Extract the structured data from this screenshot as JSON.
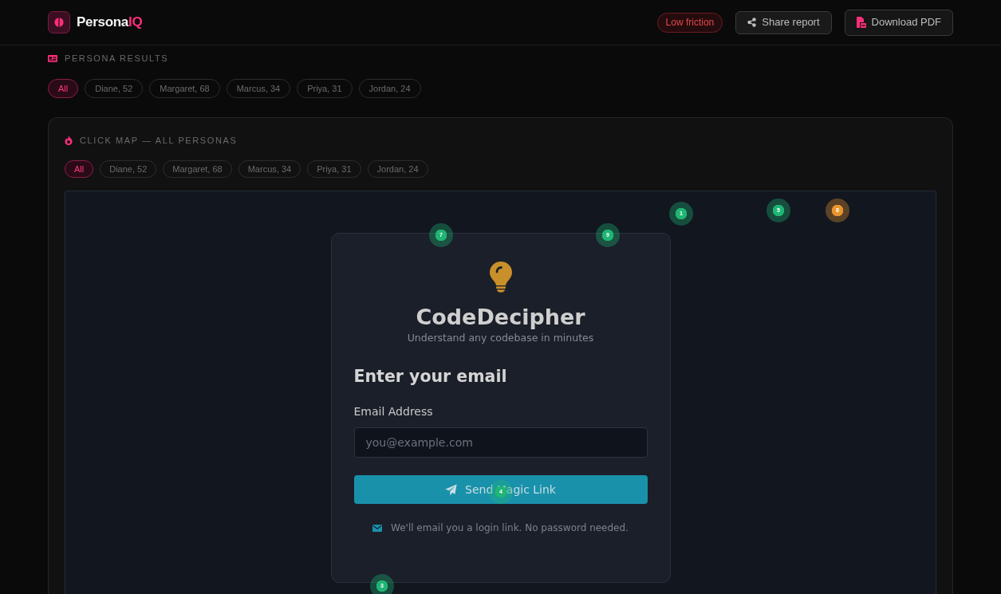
{
  "header": {
    "brand": {
      "text": "Persona",
      "accent": "IQ"
    },
    "status": "Low friction",
    "actions": [
      {
        "label": "Share report",
        "kind": "share"
      },
      {
        "label": "Download PDF",
        "kind": "pdf"
      }
    ]
  },
  "persona_results": {
    "title": "PERSONA RESULTS",
    "filters": [
      {
        "label": "All",
        "selected": true
      },
      {
        "label": "Diane, 52",
        "selected": false
      },
      {
        "label": "Margaret, 68",
        "selected": false
      },
      {
        "label": "Marcus, 34",
        "selected": false
      },
      {
        "label": "Priya, 31",
        "selected": false
      },
      {
        "label": "Jordan, 24",
        "selected": false
      }
    ]
  },
  "click_map": {
    "title": "CLICK MAP — ALL PERSONAS",
    "filters": [
      {
        "label": "All",
        "selected": true
      },
      {
        "label": "Diane, 52",
        "selected": false
      },
      {
        "label": "Margaret, 68",
        "selected": false
      },
      {
        "label": "Marcus, 34",
        "selected": false
      },
      {
        "label": "Priya, 31",
        "selected": false
      },
      {
        "label": "Jordan, 24",
        "selected": false
      }
    ],
    "page": {
      "title": "CodeDecipher",
      "subtitle": "Understand any codebase in minutes",
      "heading": "Enter your email",
      "field": {
        "label": "Email Address",
        "placeholder": "you@example.com"
      },
      "button": "Send Magic Link",
      "note": "We'll email you a login link. No password needed."
    },
    "markers": [
      {
        "label": "1",
        "color": "#1fb574"
      },
      {
        "label": "3",
        "color": "#1fb574"
      },
      {
        "label": "4",
        "color": "#1fb574"
      },
      {
        "label": "5",
        "color": "#1fb574"
      },
      {
        "label": "7",
        "color": "#1fb574"
      },
      {
        "label": "8",
        "color": "#e8952f"
      },
      {
        "label": "9",
        "color": "#1fb574"
      }
    ]
  }
}
